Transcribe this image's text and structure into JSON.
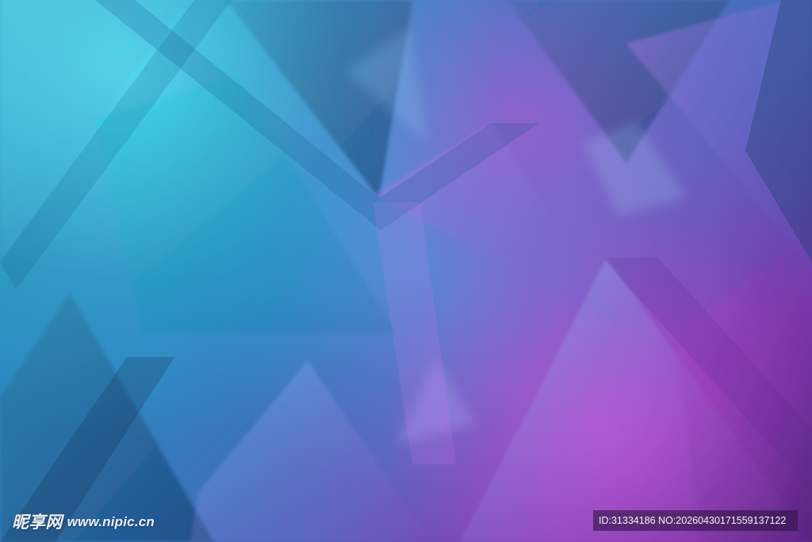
{
  "watermark": {
    "site_name": "昵享网",
    "site_url": "www.nipic.cn",
    "image_id": "ID:31334186 NO:20260430171559137122"
  },
  "visual": {
    "style": "abstract blurred geometric triangle background",
    "primary_colors": [
      "#28d6e8",
      "#2aa6d9",
      "#4b73c5",
      "#9b45c8",
      "#b03fbf",
      "#4b1f74"
    ],
    "shape_name": "triangle-pattern"
  }
}
